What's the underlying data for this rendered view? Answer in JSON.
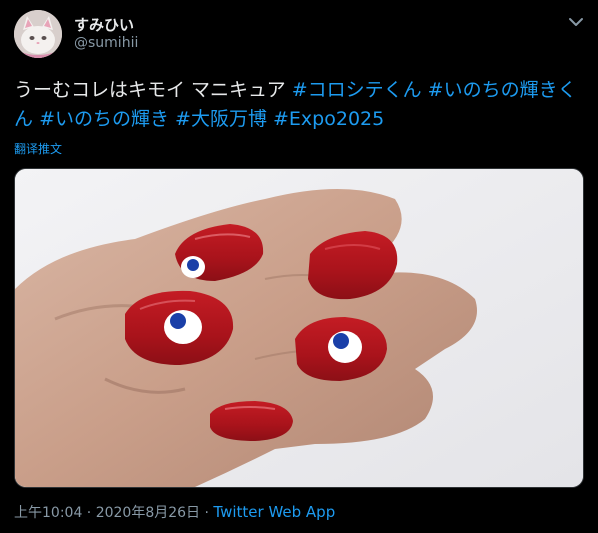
{
  "user": {
    "display_name": "すみひい",
    "handle": "@sumihii"
  },
  "tweet": {
    "text_plain": "うーむコレはキモイ マニキュア ",
    "hashtags": [
      "#コロシテくん",
      "#いのちの輝きくん",
      "#いのちの輝き",
      "#大阪万博",
      "#Expo2025"
    ],
    "translate_label": "翻译推文",
    "timestamp": "上午10:04 · 2020年8月26日",
    "separator": " · ",
    "source": "Twitter Web App"
  },
  "icons": {
    "more": "chevron-down-icon"
  },
  "colors": {
    "background": "#000000",
    "text": "#e7e9ea",
    "link": "#1d9bf0",
    "muted": "#8899a6",
    "nail_red": "#b3161d"
  }
}
